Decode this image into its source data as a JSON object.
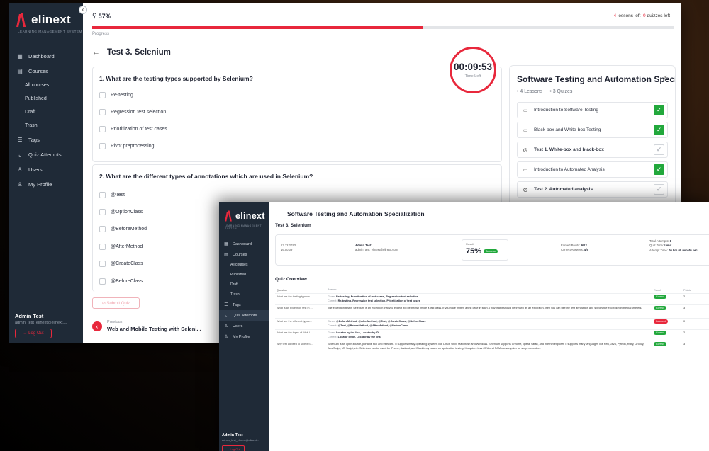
{
  "win1": {
    "sidebar": {
      "logo": "elinext",
      "logo_sub": "LEARNING MANAGEMENT SYSTEM",
      "collapse": "‹",
      "items": [
        {
          "label": "Dashboard",
          "icon": "grid-icon",
          "glyph": "▦"
        },
        {
          "label": "Courses",
          "icon": "book-icon",
          "glyph": "▤"
        },
        {
          "label": "All courses"
        },
        {
          "label": "Published"
        },
        {
          "label": "Draft"
        },
        {
          "label": "Trash"
        },
        {
          "label": "Tags",
          "icon": "list-icon",
          "glyph": "☰"
        },
        {
          "label": "Quiz Attempts",
          "icon": "chart-icon",
          "glyph": "⌞"
        },
        {
          "label": "Users",
          "icon": "users-icon",
          "glyph": "♙"
        },
        {
          "label": "My Profile",
          "icon": "profile-icon",
          "glyph": "♙"
        }
      ],
      "user_name": "Admin Test",
      "user_email": "admin_test_elinext@elinext....",
      "logout": "→ Log Out"
    },
    "progress": {
      "icon": "award-icon",
      "percent_text": "57%",
      "percent": 57,
      "label": "Progress",
      "lessons_left_num": "4",
      "lessons_left_text": " lessons left",
      "quizzes_left_num": "0",
      "quizzes_left_text": " quizzes left"
    },
    "back_arrow": "←",
    "test_title": "Test 3. Selenium",
    "timer": {
      "value": "00:09:53",
      "label": "Time Left"
    },
    "questions": [
      {
        "title": "1. What are the testing types supported by Selenium?",
        "options": [
          "Re-testing",
          "Regression test selection",
          "Prioritization of test cases",
          "Pivot preprocessing"
        ]
      },
      {
        "title": "2. What are the different types of annotations which are used in Selenium?",
        "options": [
          "@Test",
          "@OptionClass",
          "@BeforeMethod",
          "@AfterMethod",
          "@CreateClass",
          "@BeforeClass"
        ]
      }
    ],
    "submit": "⊘  Submit Quiz",
    "previous": {
      "label": "Previous",
      "title": "Web and Mobile Testing with Seleni..."
    },
    "course_panel": {
      "title": "Software Testing and Automation Speci...",
      "close": "✕",
      "lessons": "• 4 Lessons",
      "quizzes": "• 3 Quizes",
      "items": [
        {
          "label": "Introduction to Software Testing",
          "type": "lesson",
          "done": true
        },
        {
          "label": "Black-box and White-box Testing",
          "type": "lesson",
          "done": true
        },
        {
          "label": "Test 1. White-box and black-box",
          "type": "quiz",
          "done": false
        },
        {
          "label": "Introduction to Automated Analysis",
          "type": "lesson",
          "done": true
        },
        {
          "label": "Test 2. Automated analysis",
          "type": "quiz",
          "done": false
        }
      ]
    }
  },
  "win2": {
    "sidebar": {
      "logo": "elinext",
      "logo_sub": "LEARNING MANAGEMENT SYSTEM",
      "items": [
        {
          "label": "Dashboard"
        },
        {
          "label": "Courses"
        },
        {
          "label": "All courses"
        },
        {
          "label": "Published"
        },
        {
          "label": "Draft"
        },
        {
          "label": "Trash"
        },
        {
          "label": "Tags"
        },
        {
          "label": "Quiz Attempts"
        },
        {
          "label": "Users"
        },
        {
          "label": "My Profile"
        }
      ],
      "user_name": "Admin Test",
      "user_email": "admin_test_elinext@elinext....",
      "logout": "→ Log Out"
    },
    "back_arrow": "←",
    "course_title": "Software Testing and Automation Specialization",
    "test_title": "Test 3. Selenium",
    "result_card": {
      "date": "13.12.2023",
      "time": "16:00:09",
      "user_name": "Admin Test",
      "user_email": "admin_test_elinext@elinext.com",
      "result_label": "Result",
      "result_value": "75%",
      "result_badge": "Success",
      "earned_label": "Earned Points: ",
      "earned_value": "9/12",
      "correct_label": "Correct Answers: ",
      "correct_value": "4/5",
      "attempts_label": "Total Attempts: ",
      "attempts_value": "1",
      "quiz_time_label": "Quiz Time: ",
      "quiz_time_value": "Limit",
      "attempt_time_label": "Attempt Time: ",
      "attempt_time_value": "00 hrs 00 min 40 sec"
    },
    "overview_title": "Quiz Overview",
    "table": {
      "headers": [
        "Question",
        "Answer",
        "Result",
        "Points"
      ],
      "rows": [
        {
          "question": "What are the testing types s...",
          "given_label": "Given:",
          "given": "Re-testing, Prioritization of test cases, Regression test selection",
          "correct_label": "Correct:",
          "correct": "Re-testing, Regression test selection, Prioritization of test cases",
          "result": "Correct",
          "points": "2"
        },
        {
          "question": "What is an exception test in ...",
          "given_label": "",
          "given": "The exception test in Selenium is an exception that you expect will be thrown inside a test class. If you have written a test case in such a way that it should be thrown as an exception, then you can use the test annotation and specify the exception in the parameters.",
          "correct_label": "",
          "correct": "",
          "result": "Correct",
          "points": "3"
        },
        {
          "question": "What are the different types...",
          "given_label": "Given:",
          "given": "@BeforeMethod, @AfterMethod, @Test, @CreateClass, @BeforeClass",
          "correct_label": "Correct:",
          "correct": "@Test, @BeforeMethod, @AfterMethod, @BeforeClass",
          "result": "Incorrect",
          "points": "0"
        },
        {
          "question": "What are the types of Web l...",
          "given_label": "Given:",
          "given": "Locator by the link, Locator by ID",
          "correct_label": "Correct:",
          "correct": "Locator by ID, Locator by the link",
          "result": "Correct",
          "points": "2"
        },
        {
          "question": "Why test advised to select S...",
          "given_label": "",
          "given": "Selenium is an open-source, portable tool and freeware. It supports many operating systems like Linux, Unix, Macintosh and Windows. Selenium supports Chrome, opera, safari, and internet explorer. It supports many languages like Perl, Java, Python, Ruby, Groovy, JavaScript, VB Script, etc. Selenium can be used for iPhone, Android, and Blackberry based on application testing. It requires less CPU and RAM consumption for script execution.",
          "correct_label": "",
          "correct": "",
          "result": "Correct",
          "points": "3"
        }
      ]
    }
  }
}
